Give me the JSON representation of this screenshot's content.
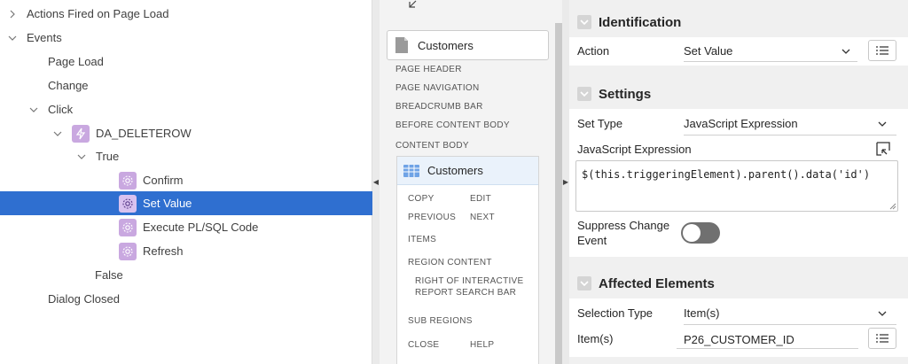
{
  "tree": {
    "items": [
      {
        "label": "Actions Fired on Page Load"
      },
      {
        "label": "Events"
      },
      {
        "label": "Page Load"
      },
      {
        "label": "Change"
      },
      {
        "label": "Click"
      },
      {
        "label": "DA_DELETEROW"
      },
      {
        "label": "True"
      },
      {
        "label": "Confirm"
      },
      {
        "label": "Set Value"
      },
      {
        "label": "Execute PL/SQL Code"
      },
      {
        "label": "Refresh"
      },
      {
        "label": "False"
      },
      {
        "label": "Dialog Closed"
      }
    ]
  },
  "layout_panel": {
    "page_card": "Customers",
    "slots": [
      "PAGE HEADER",
      "PAGE NAVIGATION",
      "BREADCRUMB BAR",
      "BEFORE CONTENT BODY",
      "CONTENT BODY"
    ],
    "region": {
      "title": "Customers",
      "slots": {
        "copy": "COPY",
        "edit": "EDIT",
        "previous": "PREVIOUS",
        "next": "NEXT",
        "items": "ITEMS",
        "region_content": "REGION CONTENT",
        "right_search_1": "RIGHT OF INTERACTIVE",
        "right_search_2": "REPORT SEARCH BAR",
        "sub_regions": "SUB REGIONS",
        "close": "CLOSE",
        "help": "HELP"
      }
    }
  },
  "properties": {
    "identification": {
      "title": "Identification",
      "action_label": "Action",
      "action_value": "Set Value"
    },
    "settings": {
      "title": "Settings",
      "set_type_label": "Set Type",
      "set_type_value": "JavaScript Expression",
      "js_label": "JavaScript Expression",
      "js_value": "$(this.triggeringElement).parent().data('id')",
      "suppress_label_1": "Suppress Change",
      "suppress_label_2": "Event",
      "suppress_on": false
    },
    "affected": {
      "title": "Affected Elements",
      "selection_type_label": "Selection Type",
      "selection_type_value": "Item(s)",
      "items_label": "Item(s)",
      "items_value": "P26_CUSTOMER_ID"
    }
  },
  "colors": {
    "selected_row": "#2f6fd0",
    "action_icon": "#c9a8e0"
  }
}
